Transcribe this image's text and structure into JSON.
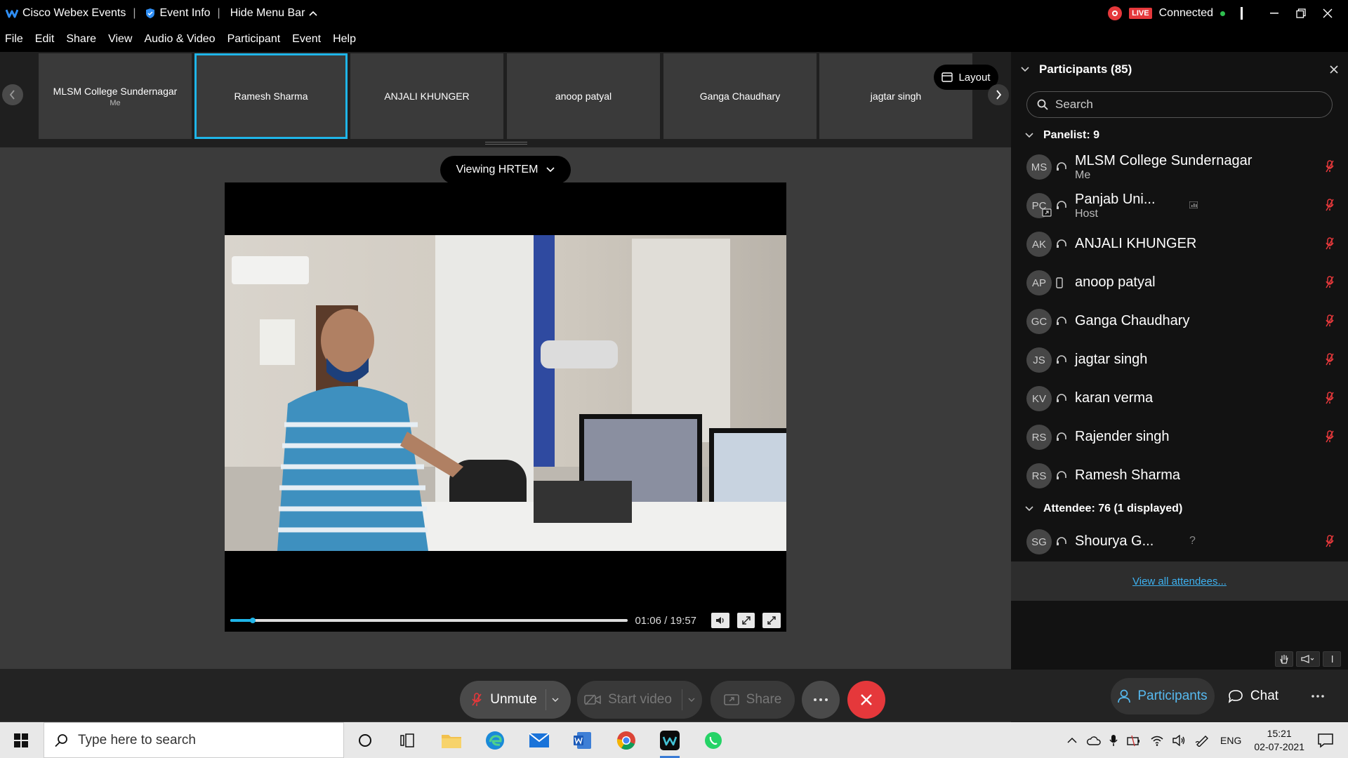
{
  "titlebar": {
    "app_name": "Cisco Webex Events",
    "event_info": "Event Info",
    "hide_menu": "Hide Menu Bar",
    "live_badge": "LIVE",
    "status": "Connected"
  },
  "menubar": [
    "File",
    "Edit",
    "Share",
    "View",
    "Audio & Video",
    "Participant",
    "Event",
    "Help"
  ],
  "filmstrip": {
    "tiles": [
      {
        "name": "MLSM College Sundernagar",
        "sub": "Me"
      },
      {
        "name": "Ramesh Sharma",
        "sub": ""
      },
      {
        "name": "ANJALI KHUNGER",
        "sub": ""
      },
      {
        "name": "anoop patyal",
        "sub": ""
      },
      {
        "name": "Ganga Chaudhary",
        "sub": ""
      },
      {
        "name": "jagtar singh",
        "sub": ""
      }
    ],
    "layout_label": "Layout"
  },
  "main": {
    "viewing_label": "Viewing HRTEM",
    "video": {
      "time": "01:06 / 19:57",
      "progress": 0.055
    }
  },
  "controls": {
    "unmute": "Unmute",
    "start_video": "Start video",
    "share": "Share"
  },
  "panel": {
    "title": "Participants (85)",
    "search_placeholder": "Search",
    "panelist_header": "Panelist: 9",
    "panelists": [
      {
        "initials": "MS",
        "name": "MLSM College Sundernagar",
        "role": "Me",
        "audio": "headset"
      },
      {
        "initials": "PC",
        "name": "Panjab Uni...",
        "role": "Host",
        "audio": "headset"
      },
      {
        "initials": "AK",
        "name": "ANJALI KHUNGER",
        "role": "",
        "audio": "headset"
      },
      {
        "initials": "AP",
        "name": "anoop patyal",
        "role": "",
        "audio": "phone"
      },
      {
        "initials": "GC",
        "name": "Ganga Chaudhary",
        "role": "",
        "audio": "headset"
      },
      {
        "initials": "JS",
        "name": "jagtar singh",
        "role": "",
        "audio": "headset"
      },
      {
        "initials": "KV",
        "name": "karan verma",
        "role": "",
        "audio": "headset"
      },
      {
        "initials": "RS",
        "name": "Rajender singh",
        "role": "",
        "audio": "headset"
      },
      {
        "initials": "RS",
        "name": "Ramesh Sharma",
        "role": "",
        "audio": "headset"
      }
    ],
    "attendee_header": "Attendee: 76 (1 displayed)",
    "attendees": [
      {
        "initials": "SG",
        "name": "Shourya G...",
        "role": "",
        "extra": "?"
      }
    ],
    "view_all": "View all attendees...",
    "tab_participants": "Participants",
    "tab_chat": "Chat"
  },
  "taskbar": {
    "search_placeholder": "Type here to search",
    "lang": "ENG",
    "time": "15:21",
    "date": "02-07-2021"
  },
  "colors": {
    "accent": "#1fb5e8",
    "end_call": "#e5383b",
    "mute_red": "#e5383b",
    "link": "#3db1f0"
  }
}
